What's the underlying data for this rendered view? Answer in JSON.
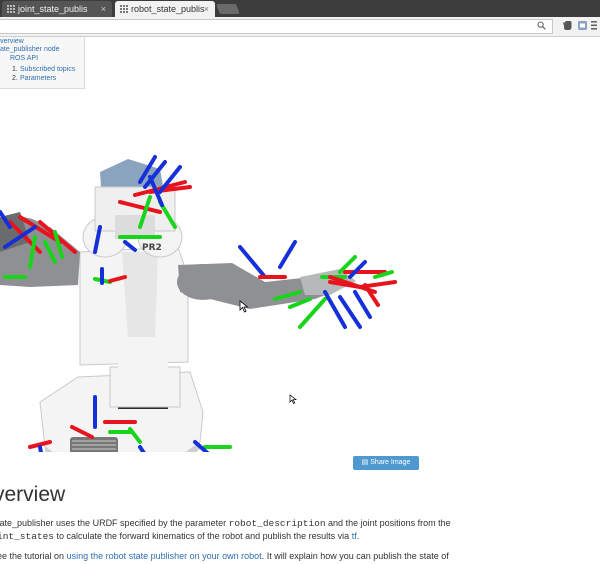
{
  "browser": {
    "tabs": [
      {
        "title": "joint_state_publis",
        "active": false
      },
      {
        "title": "robot_state_publis",
        "active": true
      }
    ],
    "close_glyph": "×",
    "toolbar_icons": [
      "search-icon",
      "star-icon",
      "evernote-icon",
      "extension-icon",
      "menu-icon"
    ]
  },
  "toc": {
    "items": [
      {
        "text": "verview"
      },
      {
        "text": "ate_publisher node"
      },
      {
        "text": "ROS API"
      },
      {
        "num": "1.",
        "text": "Subscribed topics"
      },
      {
        "num": "2.",
        "text": "Parameters"
      }
    ]
  },
  "robot_view": {
    "badge": "PR2",
    "share_label": "Share Image",
    "colors": {
      "x_axis": "#e8131c",
      "y_axis": "#19d41b",
      "z_axis": "#1530d8",
      "body": "#f4f4f4",
      "arm": "#8f9093"
    }
  },
  "content": {
    "heading": "verview",
    "p1_part1": "tate_publisher uses the URDF specified by the parameter ",
    "p1_code1": "robot_description",
    "p1_part2": " and the joint positions from the",
    "p2_code": "int_states",
    "p2_text": " to calculate the forward kinematics of the robot and publish the results via ",
    "p2_link": "tf",
    "p2_end": ".",
    "p3_part1": "ee the tutorial on ",
    "p3_link": "using the robot state publisher on your own robot",
    "p3_part2": ". It will explain how you can publish the state of"
  }
}
